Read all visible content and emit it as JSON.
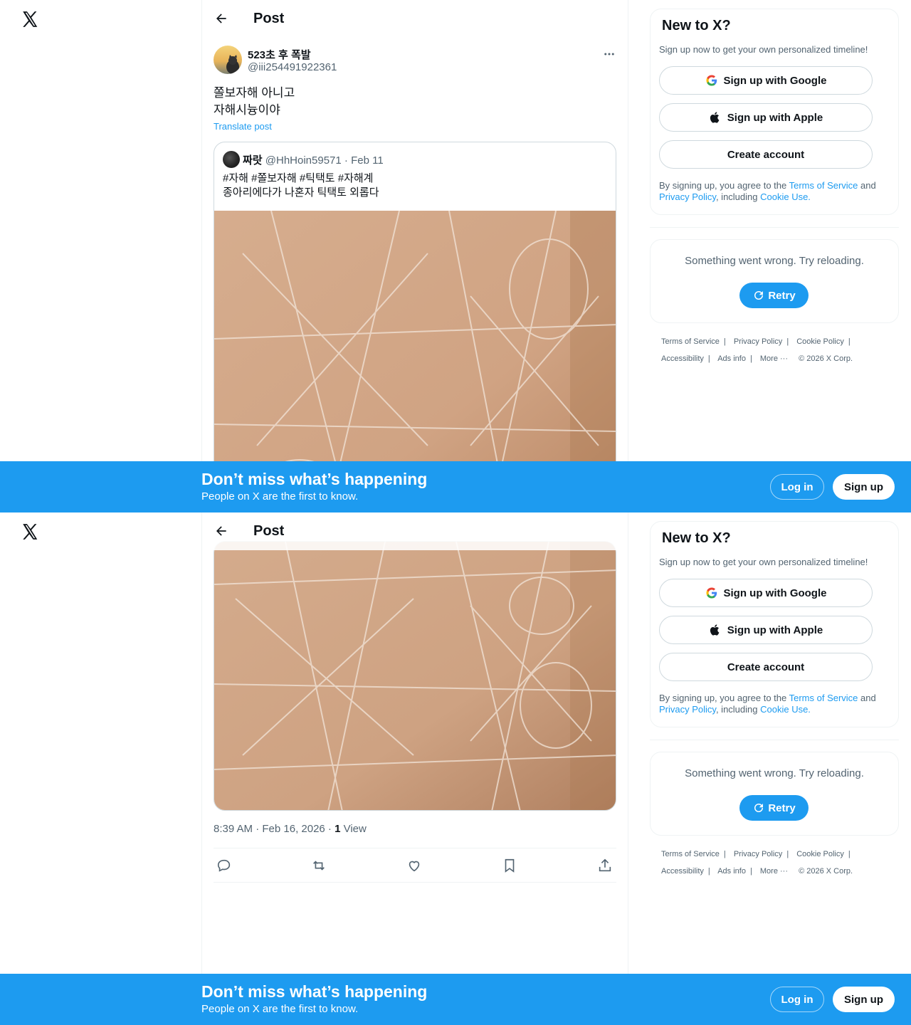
{
  "header": {
    "title": "Post"
  },
  "post": {
    "author_name": "523초 후 폭발",
    "author_handle": "@iii254491922361",
    "text_lines": [
      "쫄보자해 아니고",
      "자해시늉이야"
    ],
    "translate_label": "Translate post",
    "timestamp": "8:39 AM · Feb 16, 2026 · ",
    "views_count": "1",
    "views_label": " View"
  },
  "quote": {
    "name": "짜랏",
    "meta": " @HhHoin59571 · Feb 11",
    "text_lines": [
      "#자해 #쫄보자해 #틱택토 #자해계",
      "종아리에다가 나혼자 틱택토 외롭다"
    ]
  },
  "sidebar": {
    "new_title": "New to X?",
    "new_subtitle": "Sign up now to get your own personalized timeline!",
    "google_label": "Sign up with Google",
    "apple_label": "Sign up with Apple",
    "create_label": "Create account",
    "legal_prefix": "By signing up, you agree to the ",
    "legal_terms": "Terms of Service",
    "legal_and": " and ",
    "legal_privacy": "Privacy Policy",
    "legal_including": ", including ",
    "legal_cookie": "Cookie Use.",
    "error_text": "Something went wrong. Try reloading.",
    "retry_label": "Retry"
  },
  "footer": {
    "row1": [
      "Terms of Service",
      "Privacy Policy",
      "Cookie Policy"
    ],
    "row2": [
      "Accessibility",
      "Ads info",
      "More ···"
    ],
    "copyright": "© 2026 X Corp."
  },
  "banner": {
    "title": "Don’t miss what’s happening",
    "subtitle": "People on X are the first to know.",
    "login_label": "Log in",
    "signup_label": "Sign up"
  },
  "colors": {
    "accent": "#1d9bf0",
    "text": "#0f1419",
    "muted": "#536471",
    "border": "#eff3f4"
  },
  "icons": {
    "logo": "x-logo-icon",
    "back": "arrow-left-icon",
    "more": "more-horizontal-icon",
    "reply": "reply-icon",
    "repost": "repost-icon",
    "like": "heart-icon",
    "bookmark": "bookmark-icon",
    "share": "share-icon",
    "google": "google-icon",
    "apple": "apple-icon",
    "retry": "refresh-icon"
  }
}
